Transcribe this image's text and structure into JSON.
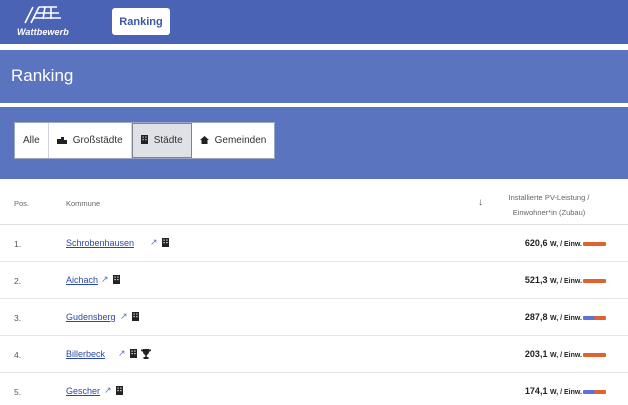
{
  "topnav": {
    "logo_text": "Wattbewerb",
    "ranking_button": "Ranking"
  },
  "page": {
    "title": "Ranking"
  },
  "filters": [
    {
      "label": "Alle",
      "icon": "",
      "icon_name": ""
    },
    {
      "label": "Großstädte",
      "icon": "🏙",
      "icon_name": "city-icon"
    },
    {
      "label": "Städte",
      "icon": "▮",
      "icon_name": "building-icon"
    },
    {
      "label": "Gemeinden",
      "icon": "🏠",
      "icon_name": "house-icon"
    }
  ],
  "table": {
    "headers": {
      "pos": "Pos.",
      "kommune": "Kommune",
      "value_line1": "Installierte PV-Leistung /",
      "value_line2": "Einwohner*in (Zubau)"
    },
    "rows": [
      {
        "pos": "1.",
        "name": "Schrobenhausen",
        "value": "620,6",
        "unit": "W, / Einw.",
        "trophy": false,
        "bar_colors": [
          "#e0632f"
        ]
      },
      {
        "pos": "2.",
        "name": "Aichach",
        "value": "521,3",
        "unit": "W, / Einw.",
        "trophy": false,
        "bar_colors": [
          "#e0632f"
        ]
      },
      {
        "pos": "3.",
        "name": "Gudensberg",
        "value": "287,8",
        "unit": "W, / Einw.",
        "trophy": false,
        "bar_colors": [
          "#5a74d6",
          "#e0632f"
        ]
      },
      {
        "pos": "4.",
        "name": "Billerbeck",
        "value": "203,1",
        "unit": "W, / Einw.",
        "trophy": true,
        "bar_colors": [
          "#e0632f"
        ]
      },
      {
        "pos": "5.",
        "name": "Gescher",
        "value": "174,1",
        "unit": "W, / Einw.",
        "trophy": false,
        "bar_colors": [
          "#5a74d6",
          "#e0632f"
        ]
      }
    ]
  },
  "colors": {
    "nav": "#4a63b4",
    "band": "#5a74bf",
    "link": "#2a48a8",
    "bar_orange": "#e0632f",
    "bar_blue": "#5a74d6"
  }
}
